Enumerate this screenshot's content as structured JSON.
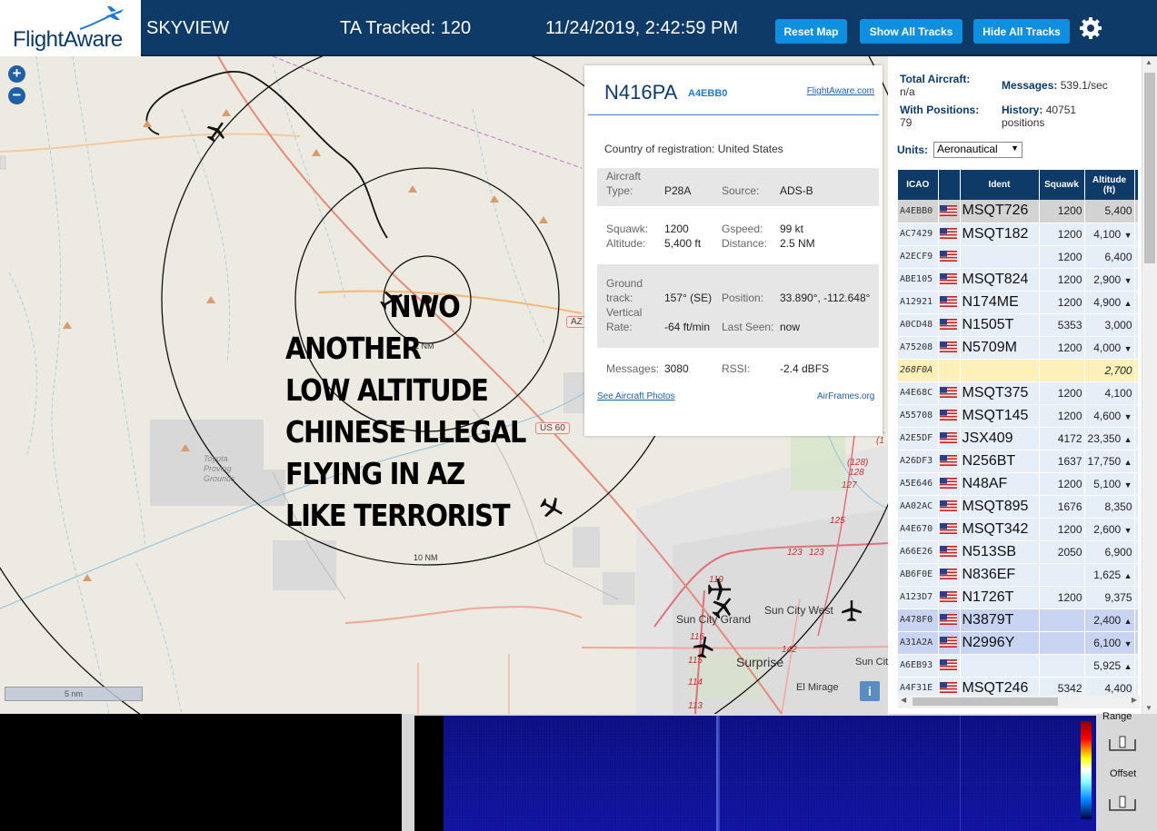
{
  "header": {
    "logo": "FlightAware",
    "app_name": "SKYVIEW",
    "tracked": "TA Tracked: 120",
    "datetime": "11/24/2019, 2:42:59 PM",
    "buttons": {
      "reset": "Reset Map",
      "show_all": "Show All Tracks",
      "hide_all": "Hide All Tracks"
    }
  },
  "map": {
    "zoom_in": "+",
    "zoom_out": "−",
    "ring_2nm": "2 NM",
    "ring_10nm": "10 NM",
    "proving_grounds": [
      "Toyota",
      "Proving",
      "Grounds"
    ],
    "towns": {
      "sun_city_grand": "Sun City Grand",
      "sun_city_west": "Sun City West",
      "surprise": "Surprise",
      "el_mirage": "El Mirage",
      "sun_city": "Sun Cit"
    },
    "shields": {
      "az": "AZ",
      "us60": "US 60"
    },
    "road_numbers": [
      "(128)",
      "128",
      "127",
      "125",
      "123",
      "123",
      "119",
      "116",
      "115",
      "114",
      "113",
      "142",
      "(1"
    ],
    "scale": "5 nm",
    "info": "i",
    "meme_lines": [
      "NWO",
      "ANOTHER",
      "LOW ALTITUDE",
      "CHINESE ILLEGAL",
      "FLYING IN AZ",
      "LIKE TERRORIST"
    ]
  },
  "detail": {
    "registration": "N416PA",
    "icao": "A4EBB0",
    "fa_link": "FlightAware.com",
    "country_label": "Country of registration:",
    "country": "United States",
    "aircraft_type_label": "Aircraft Type:",
    "aircraft_type_label_1": "Aircraft",
    "aircraft_type_label_2": "Type:",
    "aircraft_type": "P28A",
    "source_label": "Source:",
    "source": "ADS-B",
    "squawk_label": "Squawk:",
    "squawk": "1200",
    "gspeed_label": "Gspeed:",
    "gspeed": "99 kt",
    "altitude_label": "Altitude:",
    "altitude": "5,400 ft",
    "distance_label": "Distance:",
    "distance": "2.5 NM",
    "ground_track_label_1": "Ground",
    "ground_track_label_2": "track:",
    "ground_track": "157° (SE)",
    "position_label": "Position:",
    "position": "33.890°, -112.648°",
    "vrate_label_1": "Vertical",
    "vrate_label_2": "Rate:",
    "vrate": "-64 ft/min",
    "last_seen_label": "Last Seen:",
    "last_seen": "now",
    "messages_label": "Messages:",
    "messages": "3080",
    "rssi_label": "RSSI:",
    "rssi": "-2.4 dBFS",
    "photos_link": "See Aircraft Photos",
    "airframes_link": "AirFrames.org"
  },
  "stats": {
    "total_label": "Total Aircraft:",
    "total": "n/a",
    "messages_label": "Messages:",
    "messages": "539.1/sec",
    "with_positions_label": "With Positions:",
    "with_positions": "79",
    "history_label": "History:",
    "history": "40751",
    "history_unit": "positions",
    "units_label": "Units:",
    "units_value": "Aeronautical"
  },
  "table": {
    "headers": {
      "icao": "ICAO",
      "ident": "Ident",
      "squawk": "Squawk",
      "altitude": "Altitude",
      "altitude_unit": "(ft)"
    },
    "rows": [
      {
        "icao": "A4EBB0",
        "flag": true,
        "ident": "MSQT726",
        "squawk": "1200",
        "altitude": "5,400",
        "trend": "",
        "bg": "#d3d3d3"
      },
      {
        "icao": "AC7429",
        "flag": true,
        "ident": "MSQT182",
        "squawk": "1200",
        "altitude": "4,100",
        "trend": "▼",
        "bg": "#e6eef8"
      },
      {
        "icao": "A2ECF9",
        "flag": true,
        "ident": "",
        "squawk": "1200",
        "altitude": "6,400",
        "trend": "",
        "bg": "#e6eef8"
      },
      {
        "icao": "ABE105",
        "flag": true,
        "ident": "MSQT824",
        "squawk": "1200",
        "altitude": "2,900",
        "trend": "▼",
        "bg": "#e6eef8"
      },
      {
        "icao": "A12921",
        "flag": true,
        "ident": "N174ME",
        "squawk": "1200",
        "altitude": "4,900",
        "trend": "▲",
        "bg": "#e6eef8"
      },
      {
        "icao": "A0CD48",
        "flag": true,
        "ident": "N1505T",
        "squawk": "5353",
        "altitude": "3,000",
        "trend": "",
        "bg": "#e6eef8"
      },
      {
        "icao": "A75208",
        "flag": true,
        "ident": "N5709M",
        "squawk": "1200",
        "altitude": "4,000",
        "trend": "▼",
        "bg": "#e6eef8"
      },
      {
        "icao": "268F0A",
        "flag": false,
        "ident": "",
        "squawk": "",
        "altitude": "2,700",
        "trend": "",
        "bg": "#fdf0b8",
        "italic": true
      },
      {
        "icao": "A4E68C",
        "flag": true,
        "ident": "MSQT375",
        "squawk": "1200",
        "altitude": "4,100",
        "trend": "",
        "bg": "#e6eef8"
      },
      {
        "icao": "A55708",
        "flag": true,
        "ident": "MSQT145",
        "squawk": "1200",
        "altitude": "4,600",
        "trend": "▼",
        "bg": "#e6eef8"
      },
      {
        "icao": "A2E5DF",
        "flag": true,
        "ident": "JSX409",
        "squawk": "4172",
        "altitude": "23,350",
        "trend": "▲",
        "bg": "#e6eef8"
      },
      {
        "icao": "A26DF3",
        "flag": true,
        "ident": "N256BT",
        "squawk": "1637",
        "altitude": "17,750",
        "trend": "▲",
        "bg": "#e6eef8"
      },
      {
        "icao": "A5E646",
        "flag": true,
        "ident": "N48AF",
        "squawk": "1200",
        "altitude": "5,100",
        "trend": "▼",
        "bg": "#e6eef8"
      },
      {
        "icao": "AA02AC",
        "flag": true,
        "ident": "MSQT895",
        "squawk": "1676",
        "altitude": "8,350",
        "trend": "",
        "bg": "#e6eef8"
      },
      {
        "icao": "A4E670",
        "flag": true,
        "ident": "MSQT342",
        "squawk": "1200",
        "altitude": "2,600",
        "trend": "▼",
        "bg": "#e6eef8"
      },
      {
        "icao": "A66E26",
        "flag": true,
        "ident": "N513SB",
        "squawk": "2050",
        "altitude": "6,900",
        "trend": "",
        "bg": "#e6eef8"
      },
      {
        "icao": "AB6F0E",
        "flag": true,
        "ident": "N836EF",
        "squawk": "",
        "altitude": "1,625",
        "trend": "▲",
        "bg": "#e6eef8"
      },
      {
        "icao": "A123D7",
        "flag": true,
        "ident": "N1726T",
        "squawk": "1200",
        "altitude": "9,375",
        "trend": "",
        "bg": "#e6eef8"
      },
      {
        "icao": "A478F0",
        "flag": true,
        "ident": "N3879T",
        "squawk": "",
        "altitude": "2,400",
        "trend": "▲",
        "bg": "#c9d3f2"
      },
      {
        "icao": "A31A2A",
        "flag": true,
        "ident": "N2996Y",
        "squawk": "",
        "altitude": "6,100",
        "trend": "▼",
        "bg": "#c9d3f2"
      },
      {
        "icao": "A6EB93",
        "flag": true,
        "ident": "",
        "squawk": "",
        "altitude": "5,925",
        "trend": "▲",
        "bg": "#e6eef8"
      },
      {
        "icao": "A4F31E",
        "flag": true,
        "ident": "MSQT246",
        "squawk": "5342",
        "altitude": "4,400",
        "trend": "",
        "bg": "#e6eef8"
      }
    ]
  },
  "bottom": {
    "range_label": "Range",
    "offset_label": "Offset"
  }
}
